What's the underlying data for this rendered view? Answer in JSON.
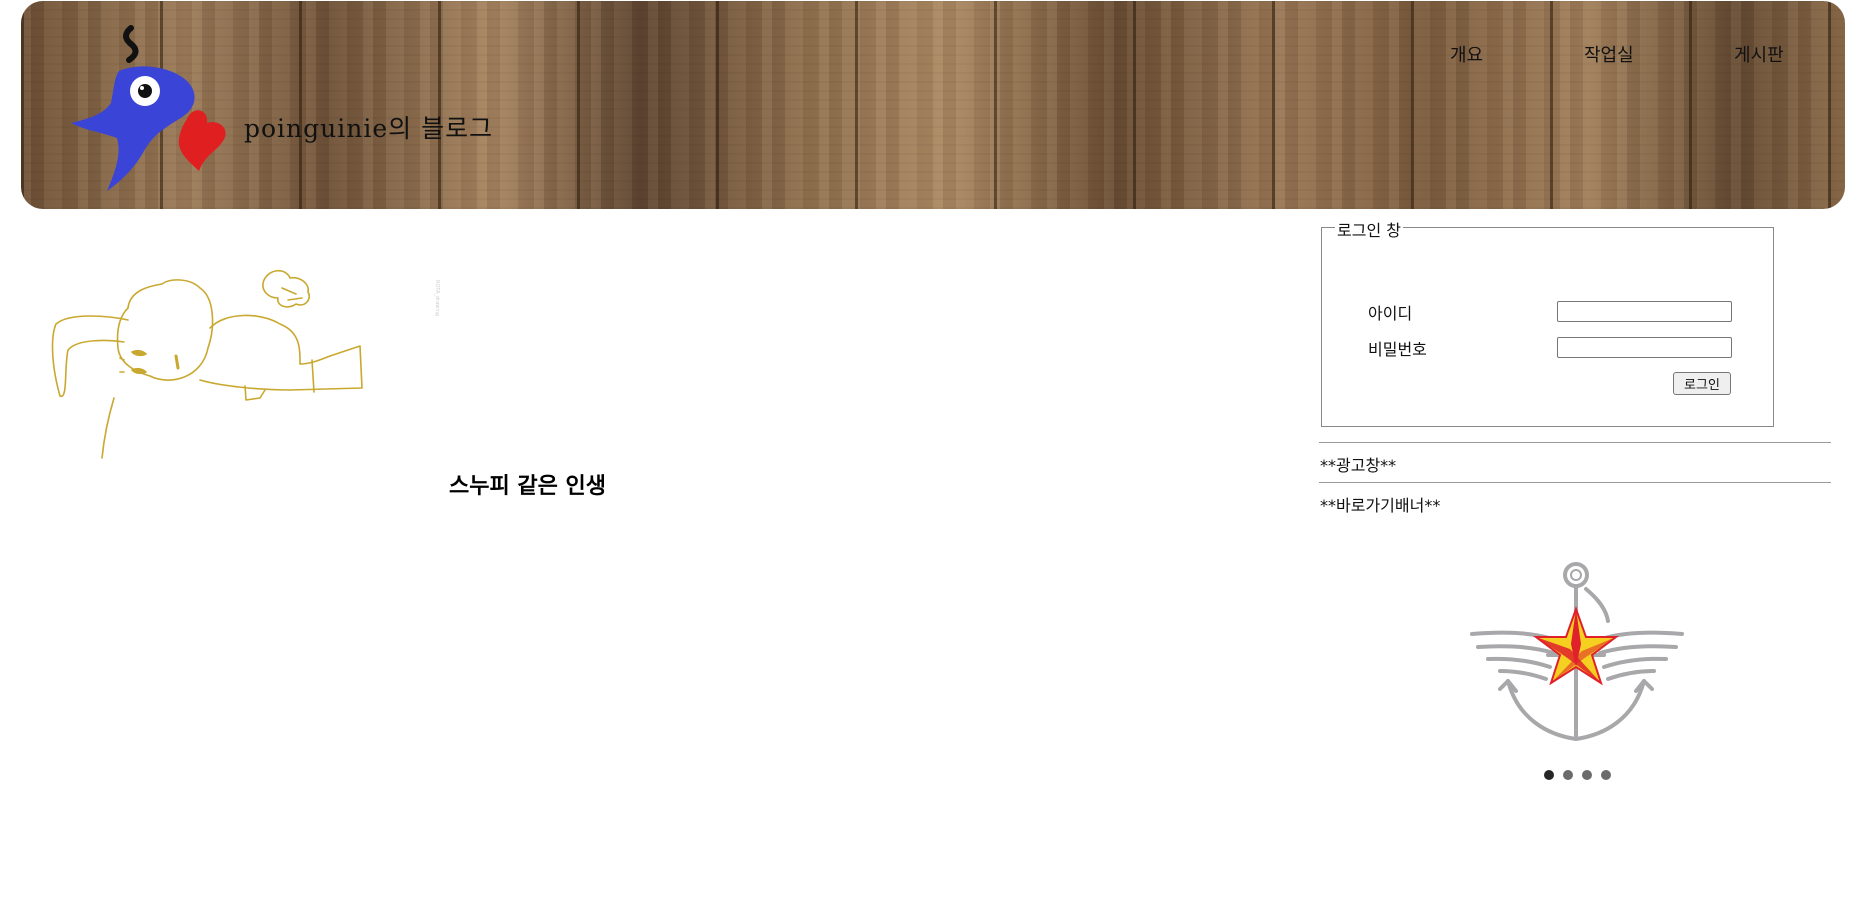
{
  "header": {
    "blog_title": "poinguinie의 블로그",
    "nav": [
      {
        "label": "개요"
      },
      {
        "label": "작업실"
      },
      {
        "label": "게시판"
      }
    ]
  },
  "main": {
    "caption": "스누피 같은 인생"
  },
  "login": {
    "legend": "로그인 창",
    "id_label": "아이디",
    "pw_label": "비밀번호",
    "id_value": "",
    "pw_value": "",
    "button_label": "로그인"
  },
  "sidebar": {
    "ad_label": "**광고창**",
    "shortcut_label": "**바로가기배너**",
    "carousel": {
      "slide_count": 4,
      "active_index": 0
    }
  },
  "colors": {
    "logo_body": "#3a44d6",
    "logo_heart": "#e02020",
    "drawing_line": "#c9a830",
    "emblem_star": "#f5d020",
    "emblem_red": "#e0202a",
    "emblem_silver": "#a8a8ab"
  }
}
